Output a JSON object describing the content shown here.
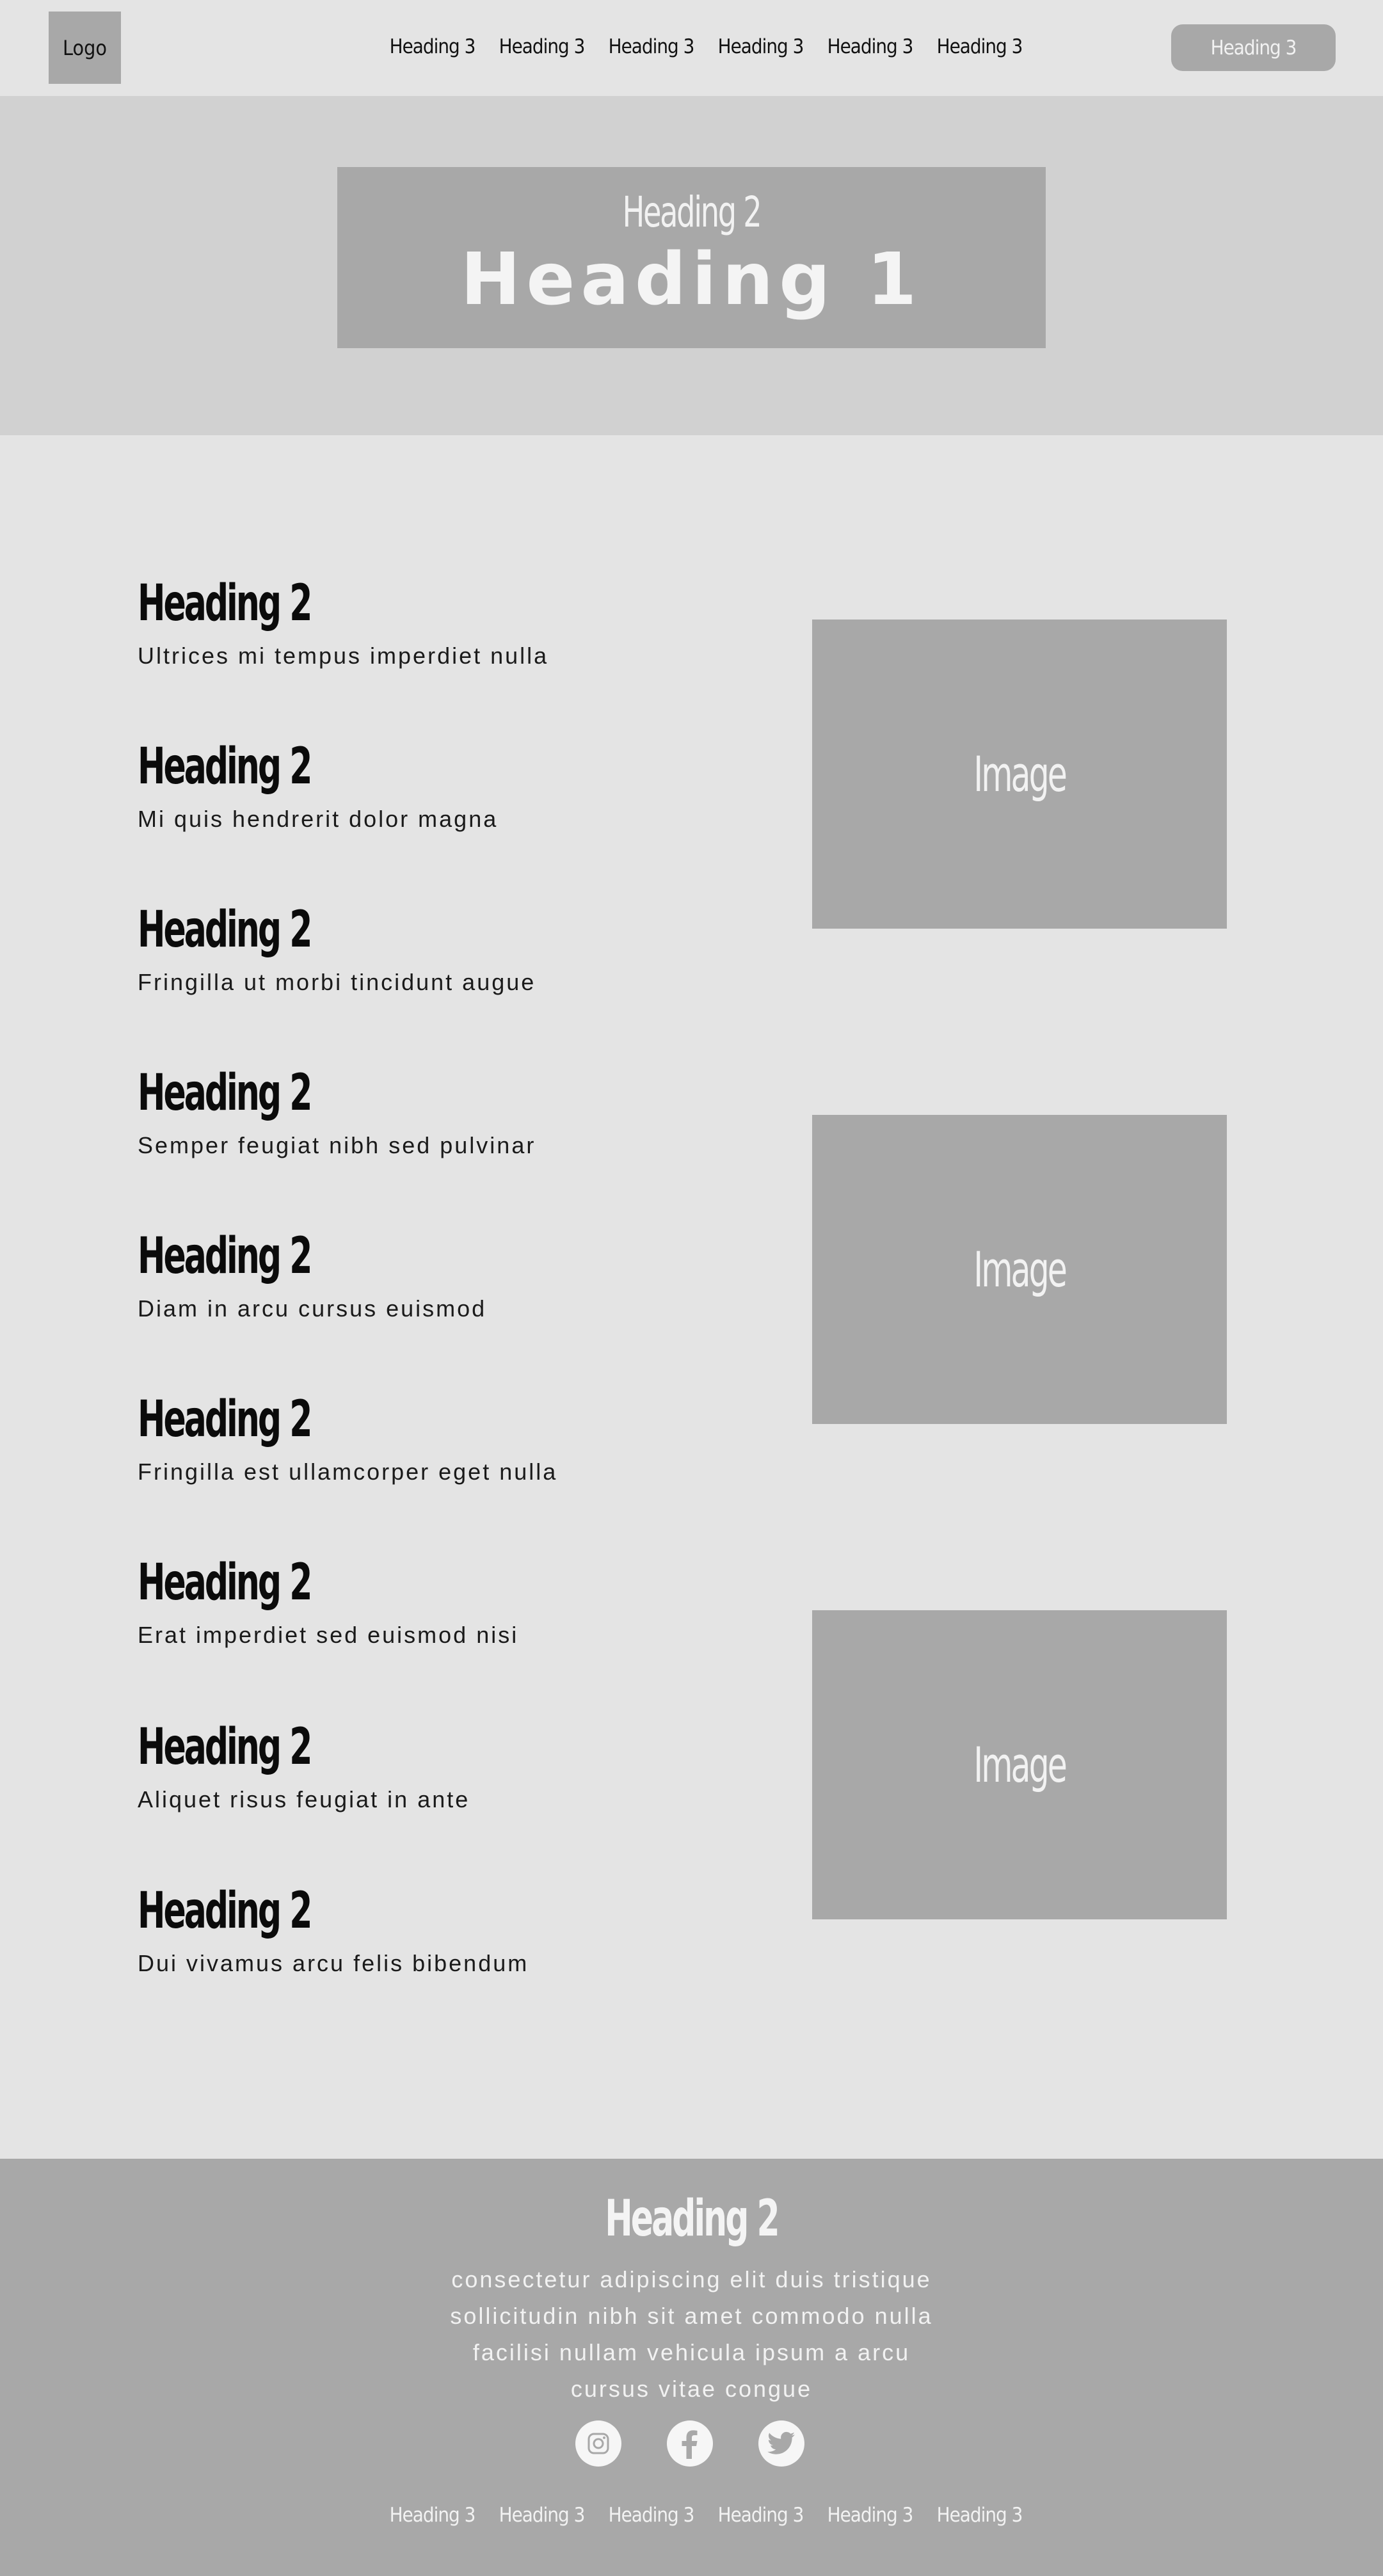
{
  "nav": {
    "logo": "Logo",
    "links": [
      "Heading 3",
      "Heading 3",
      "Heading 3",
      "Heading 3",
      "Heading 3",
      "Heading 3"
    ],
    "cta": "Heading 3"
  },
  "hero": {
    "subtitle": "Heading 2",
    "title": "Heading 1"
  },
  "features": [
    {
      "heading": "Heading 2",
      "text": "Ultrices mi tempus imperdiet nulla"
    },
    {
      "heading": "Heading 2",
      "text": "Mi quis hendrerit dolor magna"
    },
    {
      "heading": "Heading 2",
      "text": "Fringilla ut morbi tincidunt augue"
    },
    {
      "heading": "Heading 2",
      "text": "Semper feugiat nibh sed pulvinar"
    },
    {
      "heading": "Heading 2",
      "text": "Diam in arcu cursus euismod"
    },
    {
      "heading": "Heading 2",
      "text": "Fringilla est ullamcorper eget nulla"
    },
    {
      "heading": "Heading 2",
      "text": "Erat imperdiet sed euismod nisi"
    },
    {
      "heading": "Heading 2",
      "text": "Aliquet risus feugiat in ante"
    },
    {
      "heading": "Heading 2",
      "text": "Dui vivamus arcu felis bibendum"
    }
  ],
  "images": [
    "Image",
    "Image",
    "Image"
  ],
  "footer": {
    "heading": "Heading 2",
    "text_lines": [
      "consectetur adipiscing elit duis tristique",
      "sollicitudin nibh sit amet commodo nulla",
      "facilisi nullam vehicula ipsum a arcu",
      "cursus vitae congue"
    ],
    "social_icons": [
      "instagram-icon",
      "facebook-icon",
      "twitter-icon"
    ],
    "links": [
      "Heading 3",
      "Heading 3",
      "Heading 3",
      "Heading 3",
      "Heading 3",
      "Heading 3"
    ]
  },
  "colors": {
    "page_bg": "#e4e4e4",
    "hero_bg": "#d1d1d1",
    "placeholder_gray": "#a8a8a8",
    "light_text": "#f2f2f2",
    "dark_text": "#111111"
  }
}
